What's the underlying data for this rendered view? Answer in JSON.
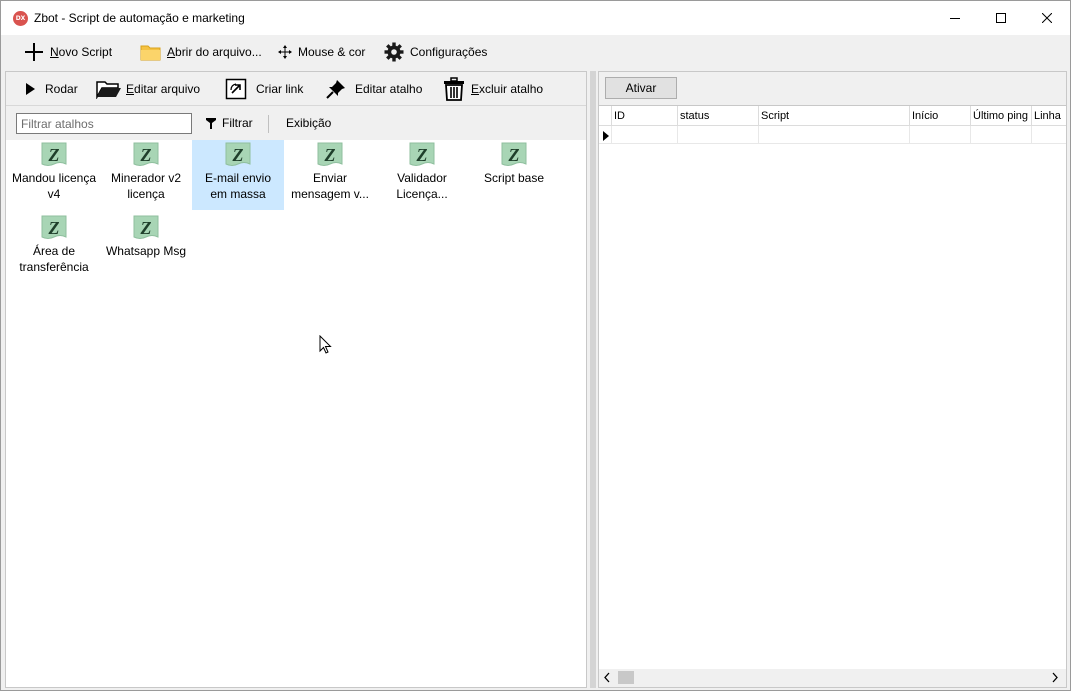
{
  "window": {
    "title": "Zbot - Script de automação e marketing",
    "app_icon_text": "DX"
  },
  "main_toolbar": {
    "novo_script": {
      "u": "N",
      "rest": "ovo Script"
    },
    "abrir_arquivo": {
      "u": "A",
      "rest": "brir do arquivo..."
    },
    "mouse_cor": "Mouse & cor",
    "configuracoes": "Configurações"
  },
  "left_toolbar": {
    "rodar": "Rodar",
    "editar_arquivo": {
      "u": "E",
      "rest": "ditar arquivo"
    },
    "criar_link": "Criar link",
    "editar_atalho": "Editar atalho",
    "excluir_atalho": {
      "u": "E",
      "rest": "xcluir atalho"
    }
  },
  "filter_bar": {
    "placeholder": "Filtrar atalhos",
    "filtrar": "Filtrar",
    "exibicao": "Exibição"
  },
  "shortcuts": [
    {
      "line1": "Mandou licença",
      "line2": "v4"
    },
    {
      "line1": "Minerador v2",
      "line2": "licença"
    },
    {
      "line1": "E-mail envio",
      "line2": "em massa"
    },
    {
      "line1": "Enviar",
      "line2": "mensagem v..."
    },
    {
      "line1": "Validador",
      "line2": "Licença..."
    },
    {
      "line1": "Script base",
      "line2": ""
    },
    {
      "line1": "Área de",
      "line2": "transferência"
    },
    {
      "line1": "Whatsapp Msg",
      "line2": ""
    }
  ],
  "selected_shortcut": "E-mail envio em massa",
  "right_panel": {
    "ativar_button": "Ativar",
    "columns": [
      "ID",
      "status",
      "Script",
      "Início",
      "Último ping",
      "Linha"
    ]
  },
  "colors": {
    "selection": "#cce8ff",
    "icon_green": "#a8d5b5",
    "folder_yellow": "#f5c242"
  }
}
